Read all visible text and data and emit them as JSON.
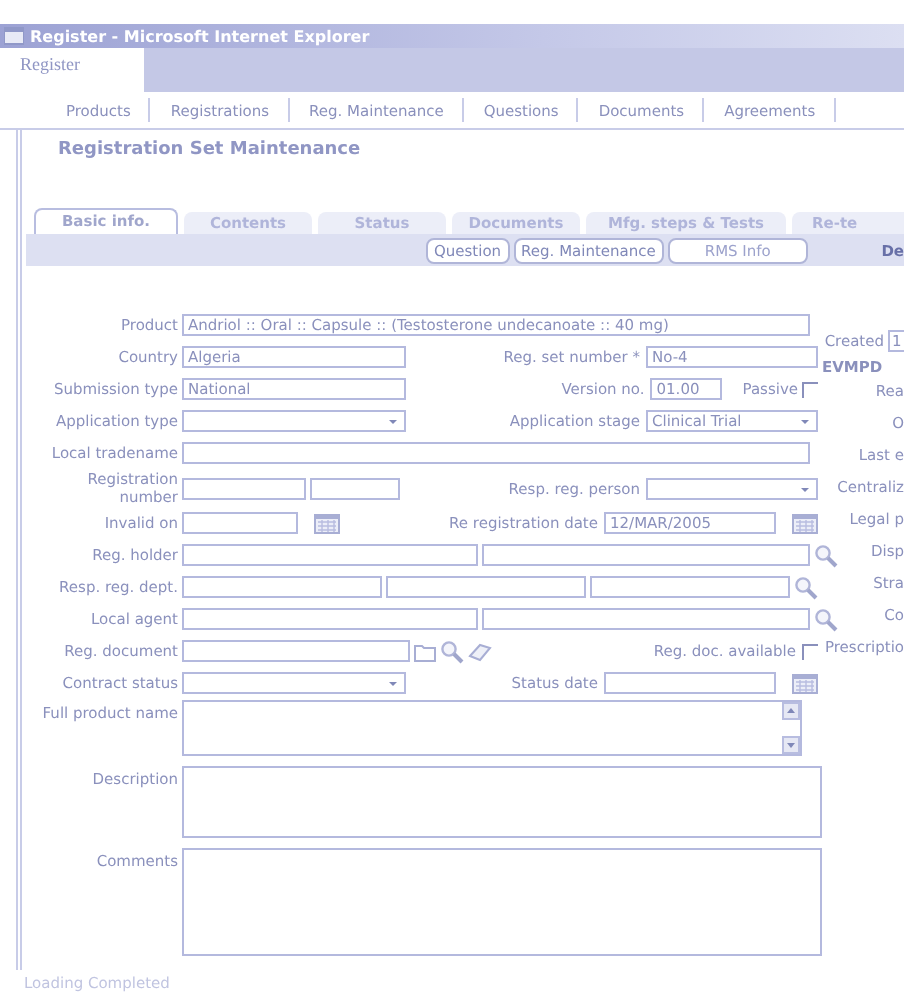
{
  "window": {
    "title": "Register - Microsoft Internet Explorer"
  },
  "logo": "Register",
  "nav": [
    "Products",
    "Registrations",
    "Reg. Maintenance",
    "Questions",
    "Documents",
    "Agreements"
  ],
  "page_title": "Registration Set Maintenance",
  "tabs": [
    {
      "label": "Basic info.",
      "selected": true
    },
    {
      "label": "Contents",
      "selected": false
    },
    {
      "label": "Status",
      "selected": false
    },
    {
      "label": "Documents",
      "selected": false
    },
    {
      "label": "Mfg. steps & Tests",
      "selected": false
    },
    {
      "label": "Re-te",
      "selected": false
    }
  ],
  "toolbar": {
    "buttons": [
      {
        "label": "Question",
        "disabled": false
      },
      {
        "label": "Reg. Maintenance",
        "disabled": false
      },
      {
        "label": "RMS Info",
        "disabled": true
      }
    ],
    "link": "De"
  },
  "form": {
    "rows": [
      {
        "label": "Product",
        "kind": "wide",
        "value": "Andriol :: Oral :: Capsule :: (Testosterone undecanoate :: 40 mg)"
      },
      {
        "label": "Country",
        "kind": "text",
        "value": "Algeria",
        "right": {
          "label": "Reg. set number *",
          "kind": "text",
          "value": "No-4"
        }
      },
      {
        "label": "Submission type",
        "kind": "text",
        "value": "National",
        "right": {
          "label": "Version no.",
          "kind": "short",
          "value": "01.00",
          "check": {
            "label": "Passive",
            "checked": false
          }
        }
      },
      {
        "label": "Application type",
        "kind": "select",
        "right": {
          "label": "Application stage",
          "kind": "select",
          "value": "Clinical Trial"
        }
      },
      {
        "label": "Local tradename",
        "kind": "wide"
      },
      {
        "label": "Registration number",
        "kind": "pair",
        "right": {
          "label": "Resp. reg. person",
          "kind": "select"
        }
      },
      {
        "label": "Invalid on",
        "kind": "date",
        "right": {
          "label": "Re registration date",
          "kind": "date",
          "value": "12/MAR/2005"
        }
      },
      {
        "label": "Reg. holder",
        "kind": "lookup2"
      },
      {
        "label": "Resp. reg. dept.",
        "kind": "lookup3"
      },
      {
        "label": "Local agent",
        "kind": "lookup2"
      },
      {
        "label": "Reg. document",
        "kind": "document",
        "right": {
          "label": "Reg. doc. available",
          "kind": "check",
          "checked": false
        }
      },
      {
        "label": "Contract status",
        "kind": "select",
        "right": {
          "label": "Status date",
          "kind": "date"
        }
      },
      {
        "label": "Full product name",
        "kind": "memo"
      },
      {
        "label": "Description",
        "kind": "big"
      },
      {
        "label": "Comments",
        "kind": "huge"
      }
    ]
  },
  "side": {
    "created_label": "Created",
    "created_value": "1",
    "section": "EVMPD",
    "labels": [
      "Rea",
      "O",
      "Last e",
      "Centraliz",
      "Legal p",
      "Disp",
      "Stra",
      "Co",
      "Prescriptio"
    ]
  },
  "status_bar": "Loading Completed"
}
